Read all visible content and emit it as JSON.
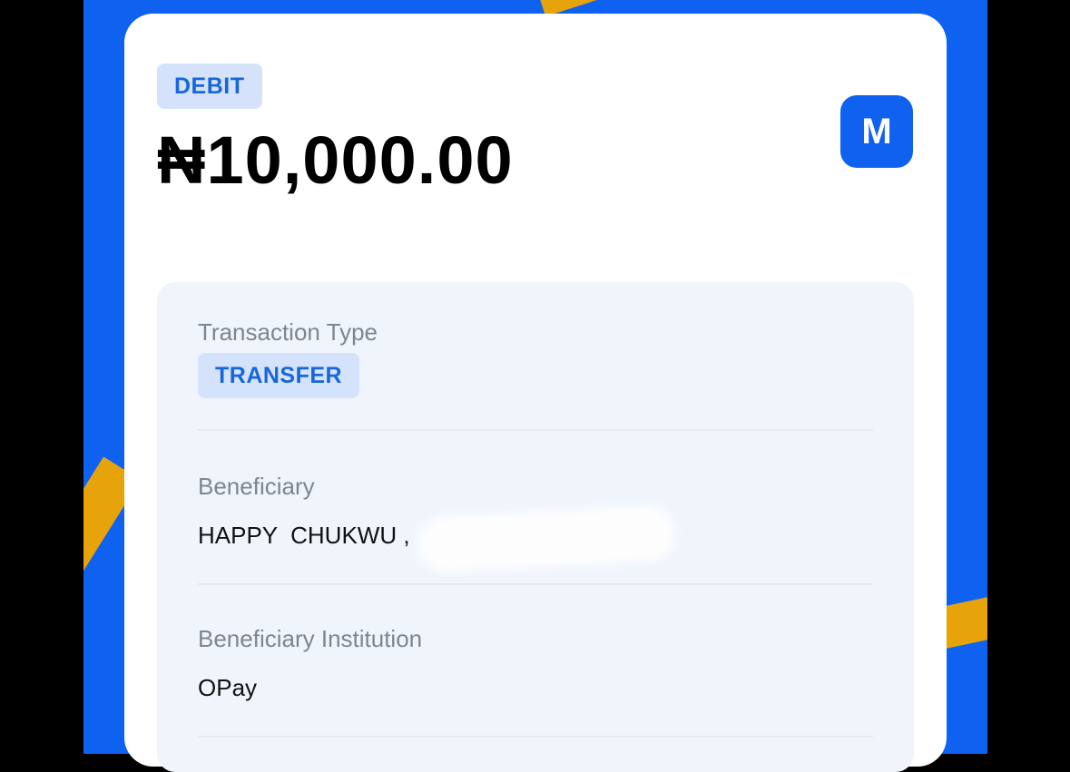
{
  "receipt": {
    "direction_badge": "DEBIT",
    "amount": "₦10,000.00",
    "brand_logo_letter": "M"
  },
  "details": {
    "transaction_type_label": "Transaction Type",
    "transaction_type_value": "TRANSFER",
    "beneficiary_label": "Beneficiary",
    "beneficiary_value": "HAPPY  CHUKWU ,",
    "institution_label": "Beneficiary Institution",
    "institution_value": "OPay"
  },
  "colors": {
    "brand_blue": "#0f62f0",
    "accent_yellow": "#e7a40a",
    "badge_bg": "#d4e3fb",
    "badge_text": "#1866d8"
  }
}
